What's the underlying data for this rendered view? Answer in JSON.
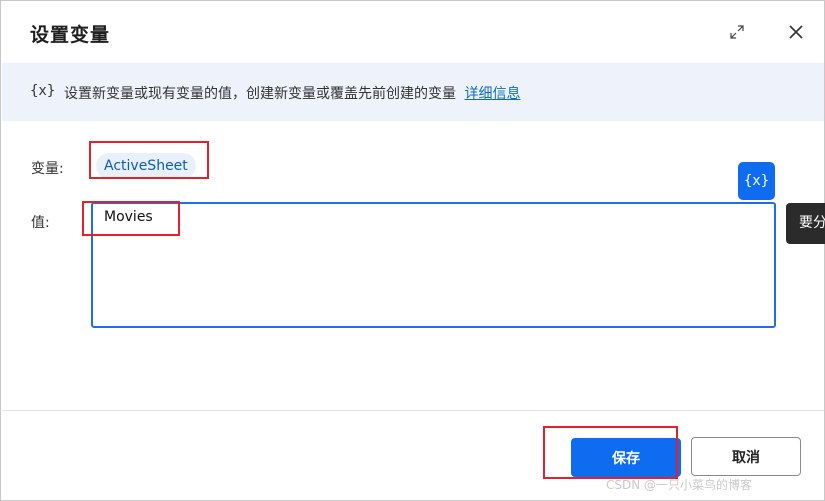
{
  "dialog": {
    "title": "设置变量",
    "info": {
      "icon_text": "{x}",
      "description": "设置新变量或现有变量的值，创建新变量或覆盖先前创建的变量",
      "link": "详细信息"
    },
    "variable_label": "变量:",
    "variable_name": "ActiveSheet",
    "value_label": "值:",
    "value": "Movies",
    "var_button_label": "{x}",
    "tooltip_text": "要分",
    "save_label": "保存",
    "cancel_label": "取消"
  },
  "watermark": "CSDN @一只小菜鸟的博客",
  "colors": {
    "accent": "#0f6cf0",
    "highlight_box": "#e0222c",
    "info_bg": "#eef3fb"
  },
  "icons": {
    "expand": "expand-icon",
    "close": "close-icon"
  }
}
